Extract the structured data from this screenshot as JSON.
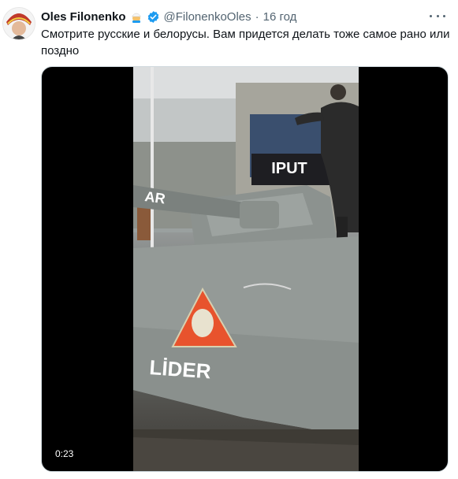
{
  "tweet": {
    "author_name": "Oles Filonenko",
    "emoji_icon": "man-in-turban-emoji",
    "verified_icon": "verified-badge-icon",
    "handle": "@FilonenkoOles",
    "separator": "·",
    "time": "16 год",
    "text": "Смотрите русские и белорусы. Вам придется делать тоже самое рано или поздно"
  },
  "media": {
    "duration": "0:23",
    "tank_marking": "LİDER",
    "banner_letters": "IPUT",
    "barrel_letters": "AR"
  },
  "colors": {
    "verified_blue": "#1d9bf0",
    "secondary_text": "#536471",
    "media_border": "#cfd9de"
  }
}
